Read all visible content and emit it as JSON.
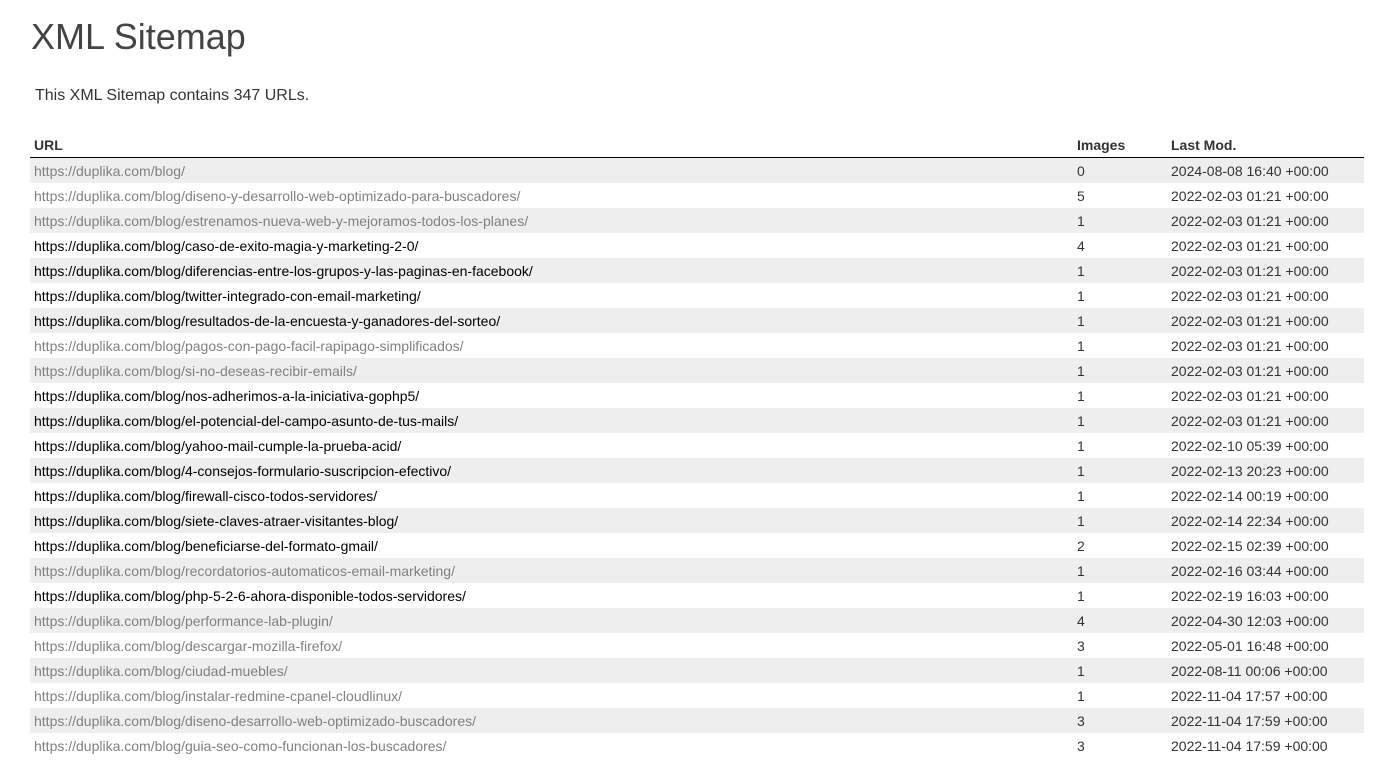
{
  "page": {
    "title": "XML Sitemap",
    "intro": "This XML Sitemap contains 347 URLs."
  },
  "table": {
    "headers": {
      "url": "URL",
      "images": "Images",
      "last_mod": "Last Mod."
    },
    "rows": [
      {
        "url": "https://duplika.com/blog/",
        "images": "0",
        "last_mod": "2024-08-08 16:40 +00:00",
        "visited": true
      },
      {
        "url": "https://duplika.com/blog/diseno-y-desarrollo-web-optimizado-para-buscadores/",
        "images": "5",
        "last_mod": "2022-02-03 01:21 +00:00",
        "visited": true
      },
      {
        "url": "https://duplika.com/blog/estrenamos-nueva-web-y-mejoramos-todos-los-planes/",
        "images": "1",
        "last_mod": "2022-02-03 01:21 +00:00",
        "visited": true
      },
      {
        "url": "https://duplika.com/blog/caso-de-exito-magia-y-marketing-2-0/",
        "images": "4",
        "last_mod": "2022-02-03 01:21 +00:00",
        "visited": false
      },
      {
        "url": "https://duplika.com/blog/diferencias-entre-los-grupos-y-las-paginas-en-facebook/",
        "images": "1",
        "last_mod": "2022-02-03 01:21 +00:00",
        "visited": false
      },
      {
        "url": "https://duplika.com/blog/twitter-integrado-con-email-marketing/",
        "images": "1",
        "last_mod": "2022-02-03 01:21 +00:00",
        "visited": false
      },
      {
        "url": "https://duplika.com/blog/resultados-de-la-encuesta-y-ganadores-del-sorteo/",
        "images": "1",
        "last_mod": "2022-02-03 01:21 +00:00",
        "visited": false
      },
      {
        "url": "https://duplika.com/blog/pagos-con-pago-facil-rapipago-simplificados/",
        "images": "1",
        "last_mod": "2022-02-03 01:21 +00:00",
        "visited": true
      },
      {
        "url": "https://duplika.com/blog/si-no-deseas-recibir-emails/",
        "images": "1",
        "last_mod": "2022-02-03 01:21 +00:00",
        "visited": true
      },
      {
        "url": "https://duplika.com/blog/nos-adherimos-a-la-iniciativa-gophp5/",
        "images": "1",
        "last_mod": "2022-02-03 01:21 +00:00",
        "visited": false
      },
      {
        "url": "https://duplika.com/blog/el-potencial-del-campo-asunto-de-tus-mails/",
        "images": "1",
        "last_mod": "2022-02-03 01:21 +00:00",
        "visited": false
      },
      {
        "url": "https://duplika.com/blog/yahoo-mail-cumple-la-prueba-acid/",
        "images": "1",
        "last_mod": "2022-02-10 05:39 +00:00",
        "visited": false
      },
      {
        "url": "https://duplika.com/blog/4-consejos-formulario-suscripcion-efectivo/",
        "images": "1",
        "last_mod": "2022-02-13 20:23 +00:00",
        "visited": false
      },
      {
        "url": "https://duplika.com/blog/firewall-cisco-todos-servidores/",
        "images": "1",
        "last_mod": "2022-02-14 00:19 +00:00",
        "visited": false
      },
      {
        "url": "https://duplika.com/blog/siete-claves-atraer-visitantes-blog/",
        "images": "1",
        "last_mod": "2022-02-14 22:34 +00:00",
        "visited": false
      },
      {
        "url": "https://duplika.com/blog/beneficiarse-del-formato-gmail/",
        "images": "2",
        "last_mod": "2022-02-15 02:39 +00:00",
        "visited": false
      },
      {
        "url": "https://duplika.com/blog/recordatorios-automaticos-email-marketing/",
        "images": "1",
        "last_mod": "2022-02-16 03:44 +00:00",
        "visited": true
      },
      {
        "url": "https://duplika.com/blog/php-5-2-6-ahora-disponible-todos-servidores/",
        "images": "1",
        "last_mod": "2022-02-19 16:03 +00:00",
        "visited": false
      },
      {
        "url": "https://duplika.com/blog/performance-lab-plugin/",
        "images": "4",
        "last_mod": "2022-04-30 12:03 +00:00",
        "visited": true
      },
      {
        "url": "https://duplika.com/blog/descargar-mozilla-firefox/",
        "images": "3",
        "last_mod": "2022-05-01 16:48 +00:00",
        "visited": true
      },
      {
        "url": "https://duplika.com/blog/ciudad-muebles/",
        "images": "1",
        "last_mod": "2022-08-11 00:06 +00:00",
        "visited": true
      },
      {
        "url": "https://duplika.com/blog/instalar-redmine-cpanel-cloudlinux/",
        "images": "1",
        "last_mod": "2022-11-04 17:57 +00:00",
        "visited": true
      },
      {
        "url": "https://duplika.com/blog/diseno-desarrollo-web-optimizado-buscadores/",
        "images": "3",
        "last_mod": "2022-11-04 17:59 +00:00",
        "visited": true
      },
      {
        "url": "https://duplika.com/blog/guia-seo-como-funcionan-los-buscadores/",
        "images": "3",
        "last_mod": "2022-11-04 17:59 +00:00",
        "visited": true
      }
    ]
  }
}
